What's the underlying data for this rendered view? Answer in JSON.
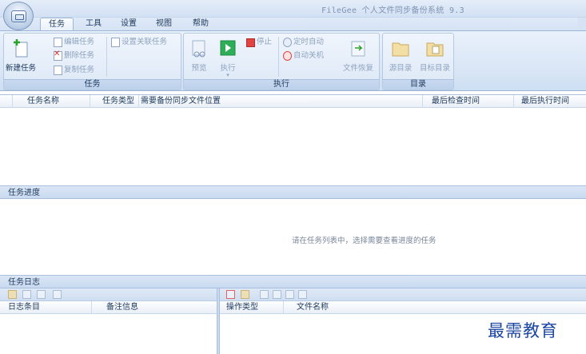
{
  "window": {
    "title": "FileGee 个人文件同步备份系统 9.3"
  },
  "tabs": [
    "任务",
    "工具",
    "设置",
    "视图",
    "帮助"
  ],
  "ribbon": {
    "task_group": {
      "label": "任务",
      "new_task": "新建任务",
      "edit_task": "编辑任务",
      "delete_task": "删除任务",
      "copy_task": "复制任务",
      "set_linked_task": "设置关联任务"
    },
    "run_group": {
      "label": "执行",
      "preview": "预览",
      "execute": "执行",
      "stop": "停止",
      "scheduled_auto": "定时自动",
      "auto_shutdown": "自动关机",
      "file_restore": "文件恢复"
    },
    "dir_group": {
      "label": "目录",
      "source_dir": "源目录",
      "target_dir": "目标目录"
    }
  },
  "task_table": {
    "columns": [
      "任务名称",
      "任务类型",
      "需要备份同步文件位置",
      "最后检查时间",
      "最后执行时间"
    ]
  },
  "progress": {
    "title": "任务进度",
    "hint": "请在任务列表中，选择需要查看进度的任务"
  },
  "log": {
    "title": "任务日志",
    "left_columns": [
      "日志条目",
      "备注信息"
    ],
    "right_columns": [
      "操作类型",
      "文件名称"
    ]
  },
  "watermark": "最需教育",
  "colors": {
    "accent": "#1e395b",
    "ribbon_bg": "#dce8f7",
    "watermark": "#1b46a3"
  }
}
